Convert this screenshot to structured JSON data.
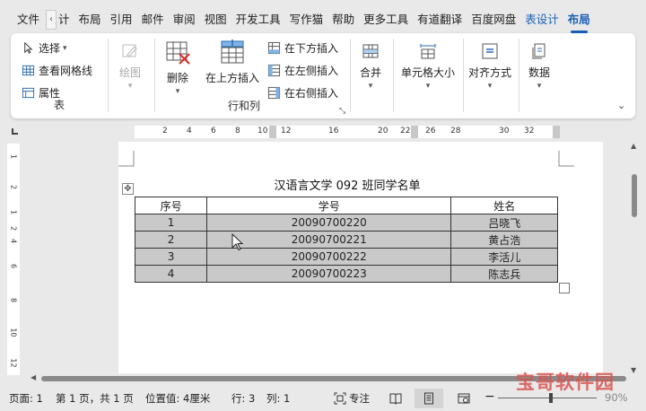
{
  "tabs": {
    "file": "文件",
    "cut": "计",
    "layout": "布局",
    "references": "引用",
    "mailings": "邮件",
    "review": "审阅",
    "view": "视图",
    "developer": "开发工具",
    "writer": "写作猫",
    "help": "帮助",
    "more_tools": "更多工具",
    "youdao": "有道翻译",
    "baidu": "百度网盘",
    "table_design": "表设计",
    "table_layout": "布局",
    "scroll_left": "‹"
  },
  "ribbon": {
    "table_group": {
      "select": "选择",
      "gridlines": "查看网格线",
      "properties": "属性",
      "label": "表"
    },
    "draw": {
      "label": "绘图"
    },
    "rows_cols": {
      "delete": "删除",
      "insert_above": "在上方插入",
      "insert_below": "在下方插入",
      "insert_left": "在左侧插入",
      "insert_right": "在右侧插入",
      "label": "行和列"
    },
    "merge": "合并",
    "cell_size": "单元格大小",
    "alignment": "对齐方式",
    "data": "数据"
  },
  "ruler": {
    "numbers": [
      "2",
      "4",
      "6",
      "8",
      "10",
      "12",
      "16",
      "20",
      "22",
      "26",
      "28",
      "30",
      "32"
    ],
    "vertical_numbers": [
      "1",
      "2",
      "1",
      "2",
      "4",
      "6",
      "8",
      "10",
      "12"
    ]
  },
  "document": {
    "title": "汉语言文学 092 班同学名单",
    "table": {
      "headers": [
        "序号",
        "学号",
        "姓名"
      ],
      "rows": [
        [
          "1",
          "20090700220",
          "吕晓飞"
        ],
        [
          "2",
          "20090700221",
          "黄占浩"
        ],
        [
          "3",
          "20090700222",
          "李活儿"
        ],
        [
          "4",
          "20090700223",
          "陈志兵"
        ]
      ]
    }
  },
  "status": {
    "page": "页面: 1",
    "page_of": "第 1 页，共 1 页",
    "position": "位置值: 4厘米",
    "line": "行: 3",
    "column": "列: 1",
    "focus": "专注",
    "zoom": "90%"
  },
  "watermark": "宝哥软件园",
  "colors": {
    "accent": "#1a5fb4",
    "table_fill": "#c9c9c9",
    "watermark": "#d9534f"
  }
}
